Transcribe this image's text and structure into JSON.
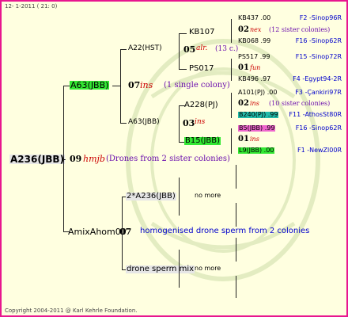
{
  "header": {
    "date": "12-  1-2011 ( 21:  0)"
  },
  "root": {
    "id": "A236(JBB)",
    "dash": "-",
    "mating": {
      "year": "09",
      "code": "hmjb",
      "note": "(Drones from 2 sister colonies)"
    }
  },
  "mother": {
    "id": "A63(JBB)",
    "mating": {
      "year": "07",
      "code": "ins",
      "note": "(1 single colony)"
    }
  },
  "gm1": {
    "id": "A22(HST)",
    "mating": {
      "year": "05",
      "code": "alr.",
      "note": "(13 c.)"
    }
  },
  "ggm1": {
    "id": "KB107"
  },
  "ggm2": {
    "id": "PS017"
  },
  "gm2": {
    "id": "A63(JBB)",
    "mating": {
      "year": "03",
      "code": "ins"
    }
  },
  "ggm3": {
    "id": "A228(PJ)"
  },
  "ggm4": {
    "id": "B15(JBB)"
  },
  "gen4": [
    {
      "id": "KB437 .00",
      "origin": "F2 -Sinop96R"
    },
    {
      "year": "02",
      "code": "nex",
      "note": "(12 sister colonies)"
    },
    {
      "id": "KB068 .99",
      "origin": "F16 -Sinop62R"
    },
    {
      "id": "PS517 .99",
      "origin": "F15 -Sinop72R"
    },
    {
      "year": "01",
      "code": "fun"
    },
    {
      "id": "KB496 .97",
      "origin": "F4 -Egypt94-2R"
    },
    {
      "id": "A101(PJ) .00",
      "origin": "F3 -Çankiri97R"
    },
    {
      "year": "02",
      "code": "ins",
      "note": "(10 sister colonies)"
    },
    {
      "id": "B240(PJ) .99",
      "origin": "F11 -AthosSt80R",
      "highlight": "teal"
    },
    {
      "id": "B5(JBB) .99",
      "origin": "F16 -Sinop62R",
      "highlight": "pink"
    },
    {
      "year": "01",
      "code": "ins"
    },
    {
      "id": "L9(JBB) .00",
      "origin": "F1 -NewZl00R",
      "highlight": "green"
    }
  ],
  "father": {
    "id": "AmixAhom00",
    "mating": {
      "year": "07",
      "note": "homogenised drone sperm from 2 colonies"
    }
  },
  "gf1": {
    "id": "2*A236(JBB)",
    "no_more": "no more"
  },
  "gf2": {
    "id": "drone sperm mix",
    "no_more": "no more"
  },
  "footer": {
    "copyright": "Copyright 2004-2011 @ Karl Kehrle Foundation."
  }
}
